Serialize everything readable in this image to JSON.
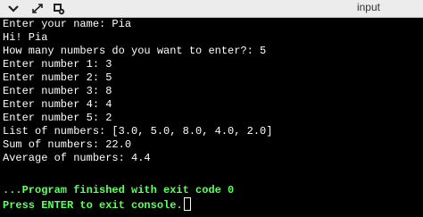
{
  "toolbar": {
    "tab_label": "input",
    "icons": [
      "chevron-down-icon",
      "expand-arrows-icon",
      "stop-gear-icon"
    ]
  },
  "console": {
    "lines": [
      "Enter your name: Pia",
      "Hi! Pia",
      "How many numbers do you want to enter?: 5",
      "Enter number 1: 3",
      "Enter number 2: 5",
      "Enter number 3: 8",
      "Enter number 4: 4",
      "Enter number 5: 2",
      "List of numbers: [3.0, 5.0, 8.0, 4.0, 2.0]",
      "Sum of numbers: 22.0",
      "Average of numbers: 4.4"
    ],
    "exit_message": "...Program finished with exit code 0",
    "prompt_message": "Press ENTER to exit console."
  },
  "colors": {
    "console_bg": "#000000",
    "text": "#ffffff",
    "status_text": "#5fff5f",
    "toolbar_bg": "#ececec"
  }
}
